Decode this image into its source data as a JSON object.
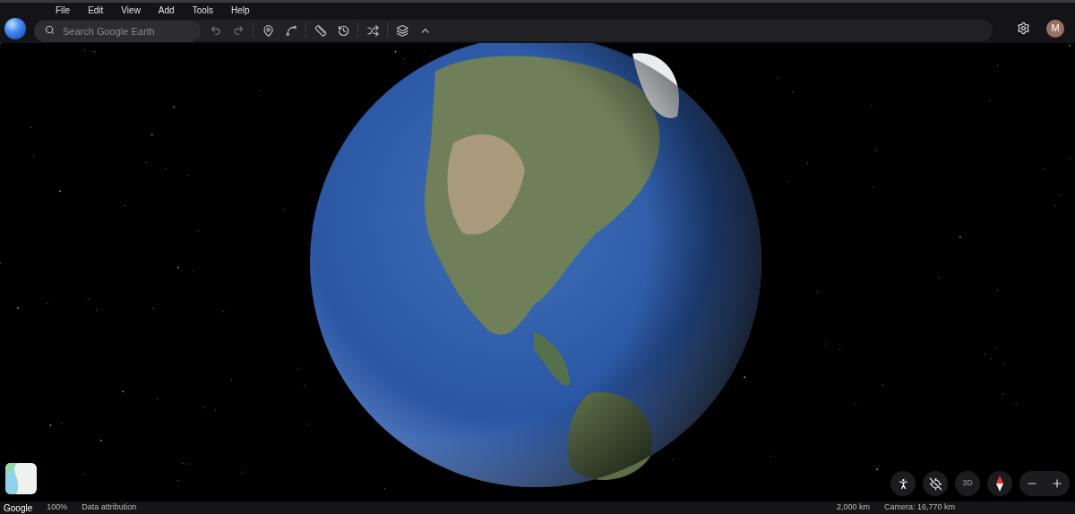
{
  "menu": [
    "File",
    "Edit",
    "View",
    "Add",
    "Tools",
    "Help"
  ],
  "search": {
    "placeholder": "Search Google Earth"
  },
  "account": {
    "initial": "M"
  },
  "view_controls": {
    "mode_label": "3D"
  },
  "status_bar": {
    "items": [
      "Google",
      "100%",
      "Data attribution"
    ],
    "scale": "2,000 km",
    "camera": "Camera: 16,770 km"
  }
}
